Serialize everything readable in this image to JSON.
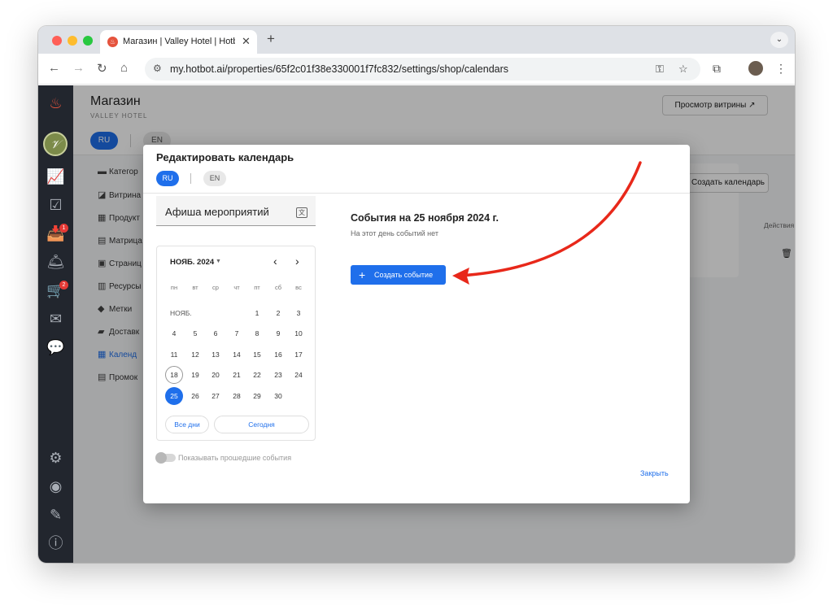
{
  "browser": {
    "tab_title": "Магазин | Valley Hotel | Hotb",
    "url": "my.hotbot.ai/properties/65f2c01f38e330001f7fc832/settings/shop/calendars"
  },
  "page": {
    "title": "Магазин",
    "subtitle": "VALLEY HOTEL",
    "view_button": "Просмотр витрины ↗",
    "lang_ru": "RU",
    "lang_en": "EN",
    "create_calendar": "Создать календарь",
    "actions_col": "Действия"
  },
  "sidebar_badges": {
    "inbox": "1",
    "cart": "2"
  },
  "menu": [
    {
      "label": "Категор",
      "icon": "storefront-icon"
    },
    {
      "label": "Витрина",
      "icon": "showcase-icon"
    },
    {
      "label": "Продукт",
      "icon": "grid-icon"
    },
    {
      "label": "Матрица",
      "icon": "matrix-icon"
    },
    {
      "label": "Страниц",
      "icon": "page-icon"
    },
    {
      "label": "Ресурсы",
      "icon": "resources-icon"
    },
    {
      "label": "Метки",
      "icon": "tag-icon"
    },
    {
      "label": "Доставк",
      "icon": "truck-icon"
    },
    {
      "label": "Календ",
      "icon": "calendar-icon"
    },
    {
      "label": "Промок",
      "icon": "promo-icon"
    }
  ],
  "modal": {
    "title": "Редактировать календарь",
    "lang_ru": "RU",
    "lang_en": "EN",
    "name_value": "Афиша мероприятий",
    "calendar": {
      "month": "НОЯБ. 2024",
      "weekdays": [
        "пн",
        "вт",
        "ср",
        "чт",
        "пт",
        "сб",
        "вс"
      ],
      "month_label": "НОЯБ.",
      "today": "18",
      "selected": "25",
      "all_days": "Все дни",
      "today_btn": "Сегодня"
    },
    "show_past": "Показывать прошедшие события",
    "events_title": "События на 25 ноября 2024 г.",
    "events_empty": "На этот день событий нет",
    "create_event": "Создать событие",
    "close": "Закрыть"
  },
  "colors": {
    "accent": "#1f6feb",
    "annotation": "#e8281a",
    "sidebar": "#22262e"
  }
}
